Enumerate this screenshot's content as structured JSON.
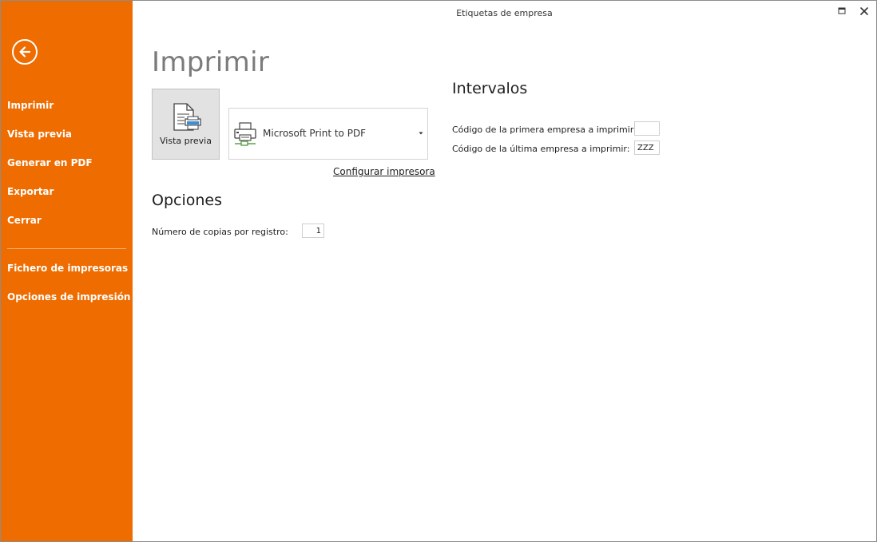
{
  "window": {
    "title": "Etiquetas de empresa"
  },
  "sidebar": {
    "back_icon": "arrow-left-icon",
    "items": [
      {
        "label": "Imprimir"
      },
      {
        "label": "Vista previa"
      },
      {
        "label": "Generar en PDF"
      },
      {
        "label": "Exportar"
      },
      {
        "label": "Cerrar"
      }
    ],
    "items_secondary": [
      {
        "label": "Fichero de impresoras"
      },
      {
        "label": "Opciones de impresión"
      }
    ]
  },
  "main": {
    "heading": "Imprimir",
    "preview_button": {
      "label": "Vista previa",
      "icon": "document-preview-icon"
    },
    "printer": {
      "selected": "Microsoft Print to PDF",
      "icon": "printer-icon"
    },
    "config_link": "Configurar impresora",
    "options": {
      "heading": "Opciones",
      "copies_label": "Número de copias por registro:",
      "copies_value": "1"
    },
    "intervals": {
      "heading": "Intervalos",
      "first_label": "Código de la primera empresa a imprimir:",
      "first_value": "",
      "last_label": "Código de la última empresa a imprimir:",
      "last_value": "ZZZ"
    }
  },
  "colors": {
    "sidebar": "#ee6c00",
    "heading_gray": "#7b7b7b"
  }
}
